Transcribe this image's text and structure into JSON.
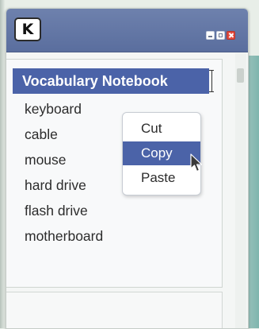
{
  "window": {
    "app_logo_letter": "K",
    "controls": [
      "minimize",
      "maximize",
      "close"
    ]
  },
  "notebook": {
    "heading": "Vocabulary Notebook",
    "items": [
      "keyboard",
      "cable",
      "mouse",
      "hard drive",
      "flash drive",
      "motherboard"
    ]
  },
  "context_menu": {
    "items": [
      "Cut",
      "Copy",
      "Paste"
    ],
    "selected": "Copy"
  },
  "icons": {
    "app": "k-logo-icon",
    "minimize": "minimize-icon",
    "maximize": "maximize-icon",
    "close": "close-icon",
    "pointer": "mouse-pointer-icon",
    "text_cursor": "text-cursor-icon"
  },
  "colors": {
    "titlebar": "#5f73a3",
    "highlight": "#4b63a8",
    "close": "#e34b3e",
    "background": "#f4f6f5"
  }
}
